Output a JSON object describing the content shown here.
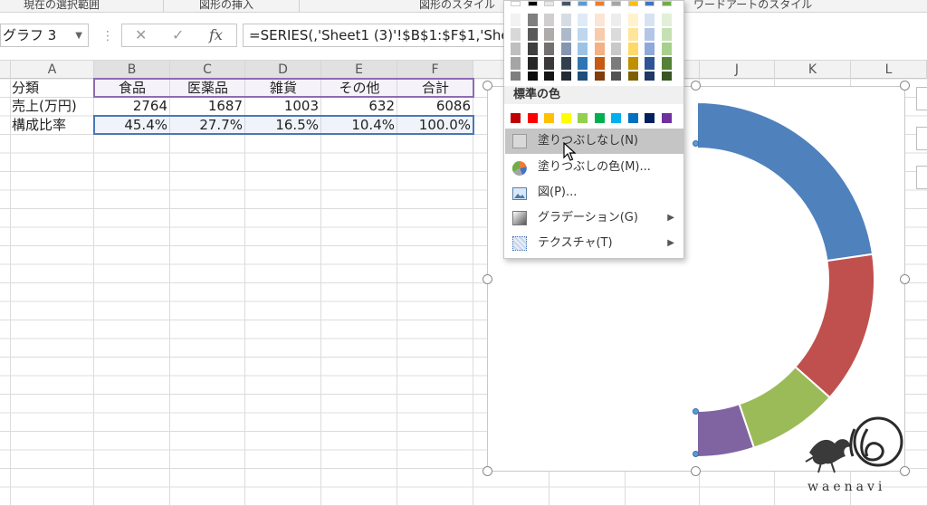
{
  "ribbon": {
    "groups": [
      "現在の選択範囲",
      "図形の挿入",
      "図形のスタイル",
      "ワードアートのスタイル"
    ]
  },
  "formula_bar": {
    "name_box": "グラフ 3",
    "cancel_icon": "✕",
    "enter_icon": "✓",
    "fx_label": "fx",
    "formula": "=SERIES(,'Sheet1 (3)'!$B$1:$F$1,'She"
  },
  "columns": [
    "A",
    "B",
    "C",
    "D",
    "E",
    "F",
    "J",
    "K",
    "L"
  ],
  "sheet": {
    "row1": [
      "分類",
      "食品",
      "医薬品",
      "雑貨",
      "その他",
      "合計"
    ],
    "row2": [
      "売上(万円)",
      "2764",
      "1687",
      "1003",
      "632",
      "6086"
    ],
    "row3": [
      "構成比率",
      "45.4%",
      "27.7%",
      "16.5%",
      "10.4%",
      "100.0%"
    ]
  },
  "menu": {
    "theme_colors": [
      [
        "#ffffff",
        "#000000",
        "#e7e6e6",
        "#44546a",
        "#5b9bd5",
        "#ed7d31",
        "#a5a5a5",
        "#ffc000",
        "#4472c4",
        "#70ad47"
      ],
      [
        "#f2f2f2",
        "#7f7f7f",
        "#d0cece",
        "#d6dce4",
        "#deebf6",
        "#fbe5d5",
        "#ededed",
        "#fff2cc",
        "#d9e2f3",
        "#e2efd9"
      ],
      [
        "#d8d8d8",
        "#595959",
        "#aeabab",
        "#adb9ca",
        "#bdd7ee",
        "#f7cbac",
        "#dbdbdb",
        "#fee599",
        "#b4c6e7",
        "#c5e0b3"
      ],
      [
        "#bfbfbf",
        "#3f3f3f",
        "#757070",
        "#8496b0",
        "#9cc3e5",
        "#f4b183",
        "#c9c9c9",
        "#ffd965",
        "#8eaadb",
        "#a8d08d"
      ],
      [
        "#a5a5a5",
        "#262626",
        "#3a3838",
        "#323f4f",
        "#2e75b5",
        "#c55a11",
        "#7b7b7b",
        "#bf9000",
        "#2f5496",
        "#538135"
      ],
      [
        "#7f7f7f",
        "#0c0c0c",
        "#171616",
        "#222a35",
        "#1e4e79",
        "#833c0b",
        "#525252",
        "#7f6000",
        "#1f3864",
        "#375623"
      ]
    ],
    "standard_title": "標準の色",
    "standard_colors": [
      "#c00000",
      "#ff0000",
      "#ffc000",
      "#ffff00",
      "#92d050",
      "#00b050",
      "#00b0f0",
      "#0070c0",
      "#002060",
      "#7030a0"
    ],
    "items": {
      "no_fill": "塗りつぶしなし(N)",
      "more_colors": "塗りつぶしの色(M)...",
      "picture": "図(P)...",
      "gradient": "グラデーション(G)",
      "texture": "テクスチャ(T)"
    }
  },
  "chart_data": {
    "type": "pie",
    "subtype": "doughnut",
    "categories": [
      "食品",
      "医薬品",
      "雑貨",
      "その他"
    ],
    "values": [
      45.4,
      27.7,
      16.5,
      10.4
    ],
    "colors": [
      "#4f81bd",
      "#c0504d",
      "#9bbb59",
      "#8064a2"
    ],
    "note_visible_half": "only the right half of the ring is visible"
  },
  "watermark": {
    "text": "waenavi"
  }
}
